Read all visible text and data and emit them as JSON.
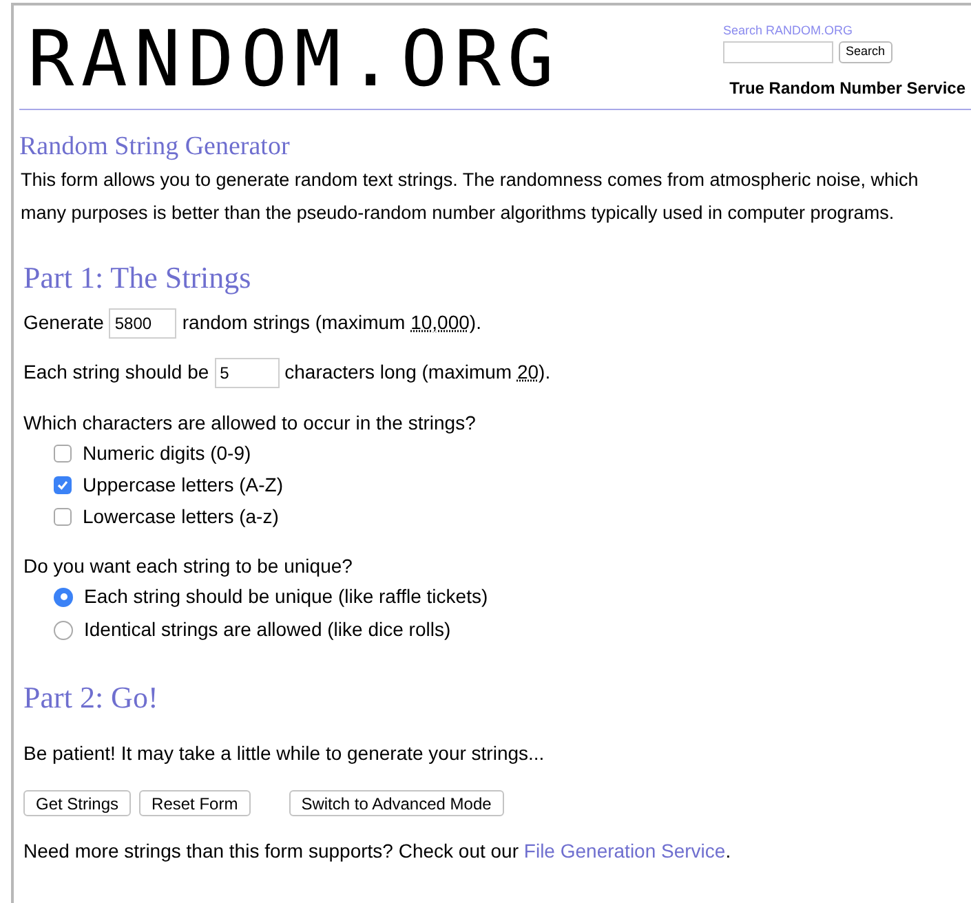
{
  "header": {
    "logo": "RANDOM.ORG",
    "search_link": "Search RANDOM.ORG",
    "search_button": "Search",
    "tagline": "True Random Number Service"
  },
  "title": "Random String Generator",
  "intro": [
    "This form allows you to generate random text strings. The randomness comes from atmospheric noise, which",
    "many purposes is better than the pseudo-random number algorithms typically used in computer programs."
  ],
  "part1": {
    "heading": "Part 1: The Strings",
    "count_row": {
      "before": "Generate",
      "value": "5800",
      "after": "random strings (maximum",
      "limit": "10,000",
      "end": ")."
    },
    "length_row": {
      "before": "Each string should be",
      "value": "5",
      "after": "characters long (maximum",
      "limit": "20",
      "end": ")."
    },
    "chars_question": "Which characters are allowed to occur in the strings?",
    "chars": [
      {
        "label": "Numeric digits (0-9)",
        "checked": false
      },
      {
        "label": "Uppercase letters (A-Z)",
        "checked": true
      },
      {
        "label": "Lowercase letters (a-z)",
        "checked": false
      }
    ],
    "unique_question": "Do you want each string to be unique?",
    "unique_options": [
      {
        "label": "Each string should be unique (like raffle tickets)",
        "selected": true
      },
      {
        "label": "Identical strings are allowed (like dice rolls)",
        "selected": false
      }
    ]
  },
  "part2": {
    "heading": "Part 2: Go!",
    "note": "Be patient! It may take a little while to generate your strings...",
    "buttons": [
      "Get Strings",
      "Reset Form",
      "Switch to Advanced Mode"
    ],
    "footer_text": "Need more strings than this form supports? Check out our",
    "footer_link": "File Generation Service",
    "footer_end": "."
  }
}
